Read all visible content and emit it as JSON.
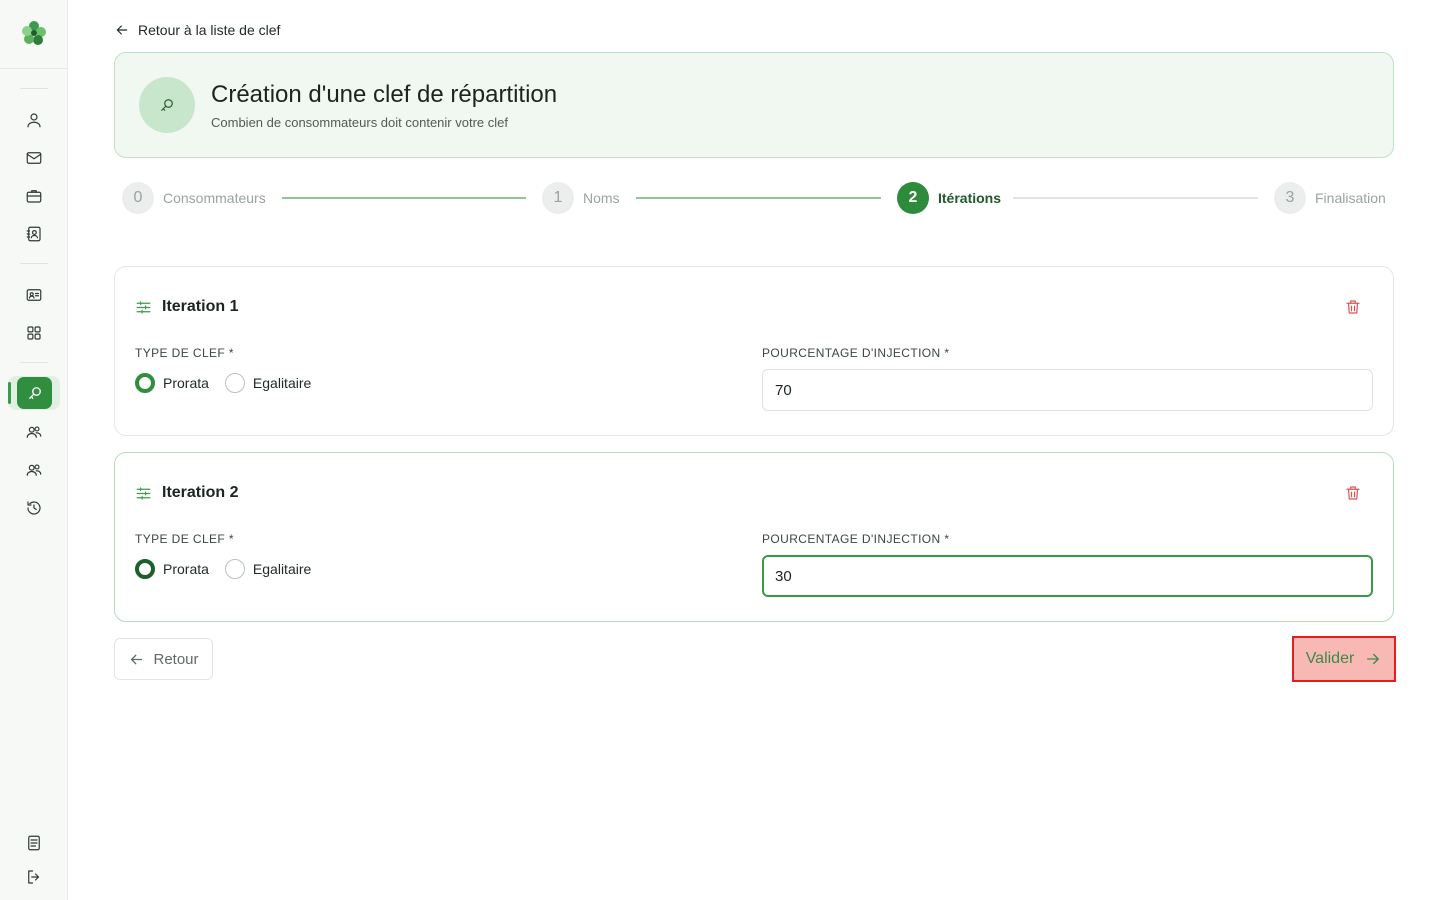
{
  "nav": {
    "back_link": "Retour à la liste de clef",
    "icons": [
      "user-icon",
      "mail-icon",
      "briefcase-icon",
      "contact-book-icon",
      "id-card-icon",
      "grid-icon",
      "key-search-icon",
      "users-icon",
      "team-icon",
      "history-icon",
      "document-icon",
      "logout-icon"
    ],
    "active_item": "key-search-icon"
  },
  "header": {
    "title": "Création d'une clef de répartition",
    "subtitle": "Combien de consommateurs doit contenir votre clef"
  },
  "stepper": {
    "steps": [
      {
        "number": "0",
        "label": "Consommateurs",
        "state": "done"
      },
      {
        "number": "1",
        "label": "Noms",
        "state": "done"
      },
      {
        "number": "2",
        "label": "Itérations",
        "state": "active"
      },
      {
        "number": "3",
        "label": "Finalisation",
        "state": "todo"
      }
    ]
  },
  "iterations": [
    {
      "title": "Iteration 1",
      "type_label": "TYPE DE CLEF *",
      "options": [
        "Prorata",
        "Egalitaire"
      ],
      "selected": "Prorata",
      "percent_label": "POURCENTAGE D'INJECTION *",
      "percent_value": "70"
    },
    {
      "title": "Iteration 2",
      "type_label": "TYPE DE CLEF *",
      "options": [
        "Prorata",
        "Egalitaire"
      ],
      "selected": "Prorata",
      "percent_label": "POURCENTAGE D'INJECTION *",
      "percent_value": "30"
    }
  ],
  "footer": {
    "back_label": "Retour",
    "submit_label": "Valider"
  },
  "colors": {
    "accent": "#2f8f3e",
    "header_bg": "#f1f8f1",
    "danger": "#e05252",
    "highlight_bg": "#f8b8b4",
    "highlight_border": "#e01f1f"
  }
}
